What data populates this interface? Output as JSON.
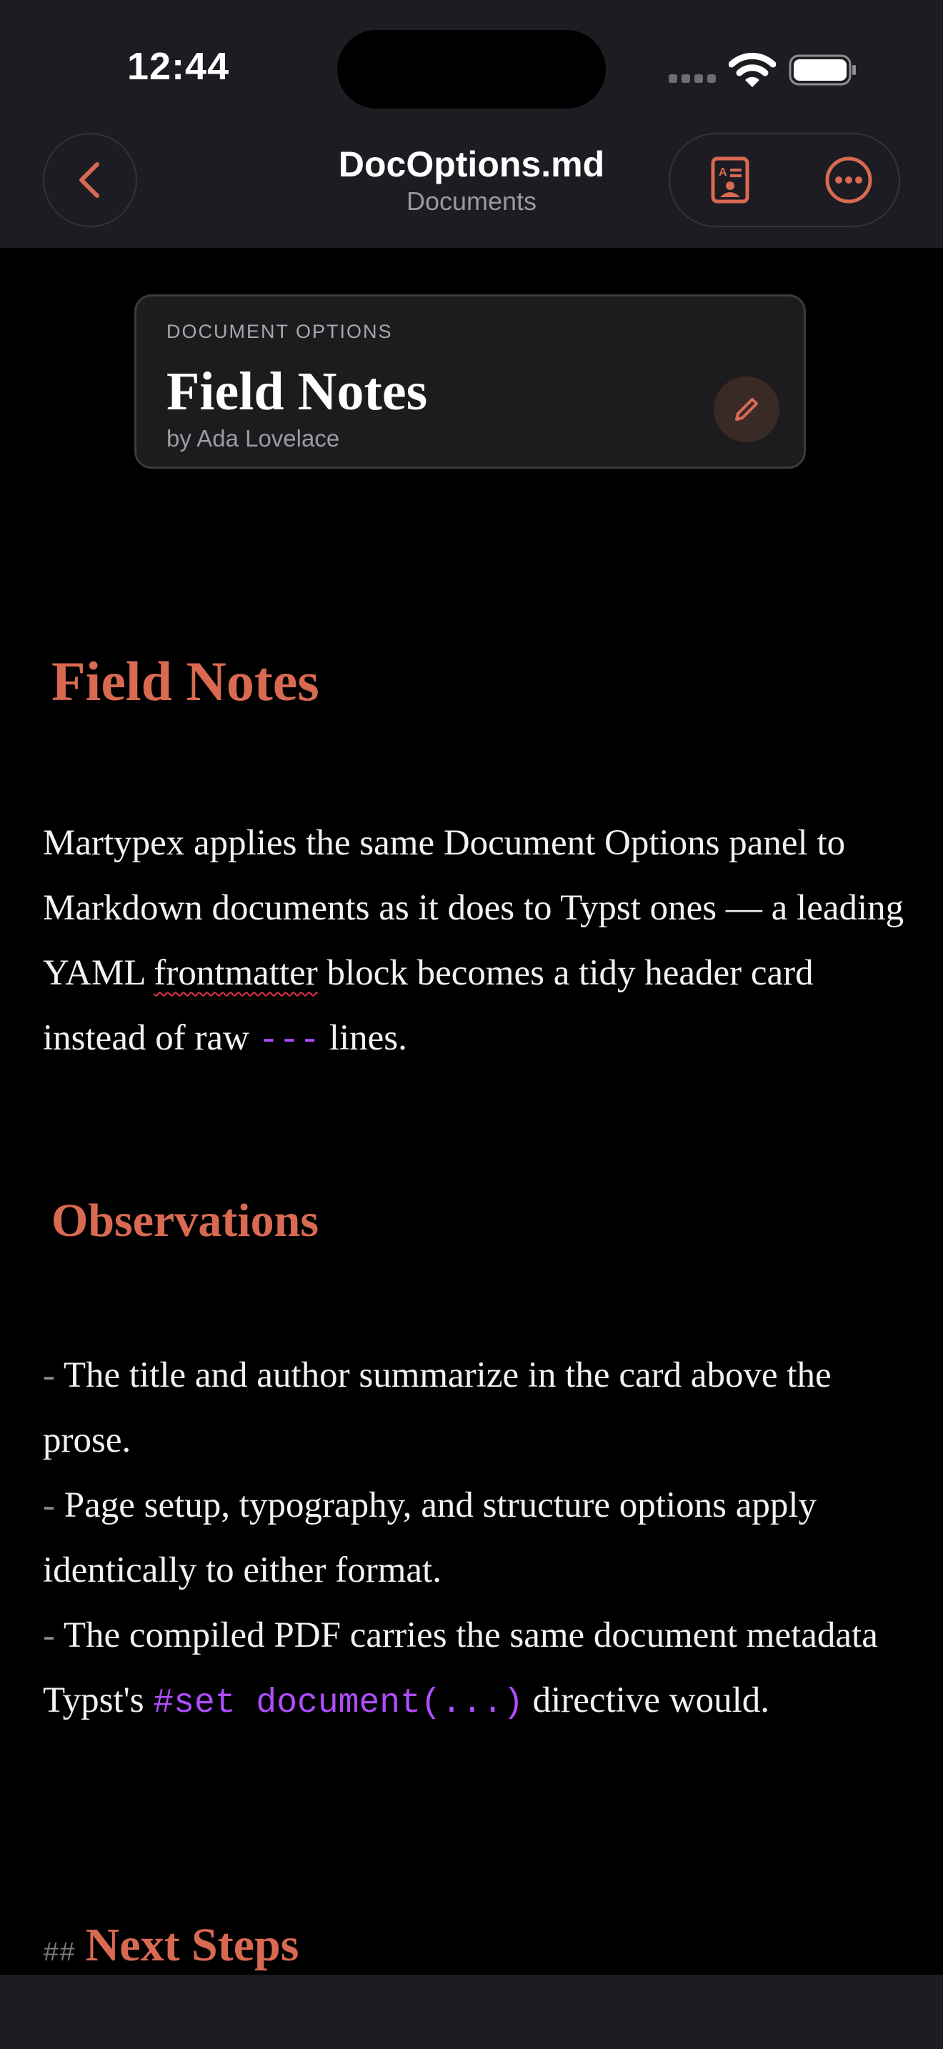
{
  "status_bar": {
    "time": "12:44"
  },
  "nav": {
    "title": "DocOptions.md",
    "subtitle": "Documents",
    "back_icon": "chevron-left-icon",
    "props_icon": "document-properties-icon",
    "more_icon": "ellipsis-circle-icon"
  },
  "card": {
    "label": "DOCUMENT OPTIONS",
    "title": "Field Notes",
    "author": "by Ada Lovelace",
    "edit_icon": "pencil-icon"
  },
  "content": {
    "heading1": "Field Notes",
    "para1": {
      "part1": "Martypex applies the same Document Options panel to Markdown documents as it does to Typst ones — a leading YAML ",
      "squiggle_word": "frontmatter",
      "part2": " block becomes a tidy header card instead of raw ",
      "code": "---",
      "part3": " lines."
    },
    "heading2": "Observations",
    "list": {
      "bullet": "-",
      "item1": " The title and author summarize in the card above the prose.",
      "item2": " Page setup, typography, and structure options apply identically to either format.",
      "item3_part1": " The compiled PDF carries the same document metadata Typst's ",
      "item3_code": "#set document(...)",
      "item3_part2": " directive would."
    },
    "heading3_marker": "##",
    "heading3": "Next Steps"
  },
  "colors": {
    "accent": "#d96a52",
    "code": "#b04dff",
    "background": "#000000",
    "bar": "#1c1c22"
  }
}
